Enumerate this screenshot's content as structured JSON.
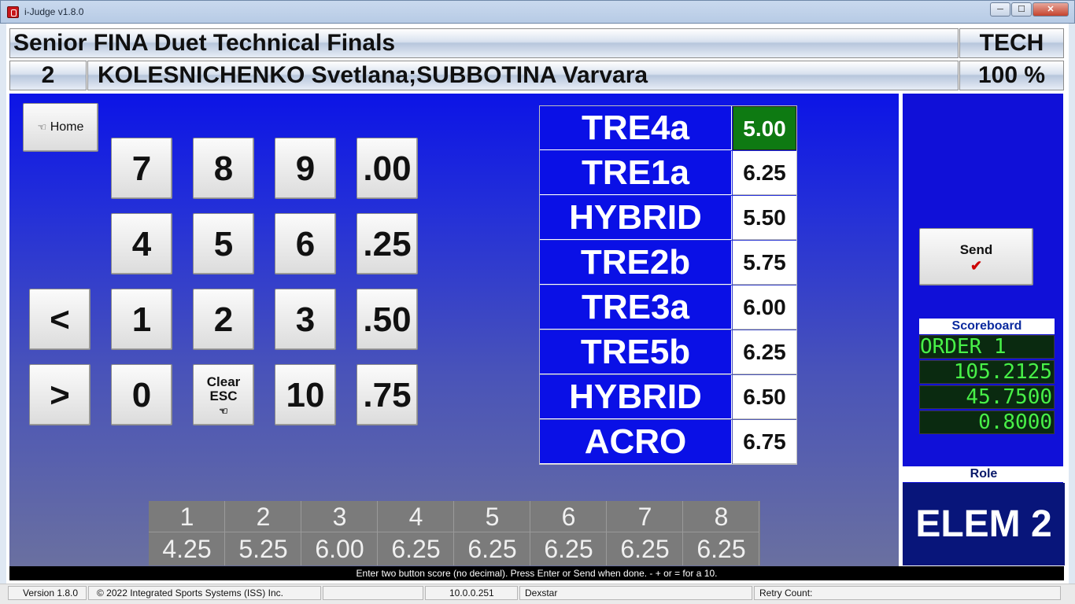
{
  "window": {
    "title": "i-Judge v1.8.0",
    "min": "─",
    "max": "☐",
    "close": "✕"
  },
  "header": {
    "event_title": "Senior FINA Duet Technical Finals",
    "category": "TECH",
    "start_number": "2",
    "competitors": "KOLESNICHENKO Svetlana;SUBBOTINA Varvara",
    "percent": "100 %"
  },
  "keypad": {
    "home": "Home",
    "keys": [
      "7",
      "8",
      "9",
      ".00",
      "4",
      "5",
      "6",
      ".25",
      "1",
      "2",
      "3",
      ".50",
      "0",
      "10",
      ".75"
    ],
    "prev": "<",
    "next": ">",
    "clear_line1": "Clear",
    "clear_line2": "ESC"
  },
  "elements": [
    {
      "name": "TRE4a",
      "score": "5.00",
      "active": true
    },
    {
      "name": "TRE1a",
      "score": "6.25"
    },
    {
      "name": "HYBRID",
      "score": "5.50"
    },
    {
      "name": "TRE2b",
      "score": "5.75"
    },
    {
      "name": "TRE3a",
      "score": "6.00"
    },
    {
      "name": "TRE5b",
      "score": "6.25"
    },
    {
      "name": "HYBRID",
      "score": "6.50"
    },
    {
      "name": "ACRO",
      "score": "6.75"
    }
  ],
  "summary": {
    "numbers": [
      "1",
      "2",
      "3",
      "4",
      "5",
      "6",
      "7",
      "8"
    ],
    "values": [
      "4.25",
      "5.25",
      "6.00",
      "6.25",
      "6.25",
      "6.25",
      "6.25",
      "6.25"
    ]
  },
  "send_label": "Send",
  "scoreboard": {
    "label": "Scoreboard",
    "line1": "ORDER   1",
    "line2": "105.2125",
    "line3": "45.7500",
    "line4": "0.8000"
  },
  "role": {
    "label": "Role",
    "value": "ELEM 2"
  },
  "instruction": "Enter two button score (no decimal). Press Enter or Send when done.   - + or = for a 10.",
  "status": {
    "version": "Version 1.8.0",
    "copyright": "© 2022 Integrated Sports Systems (ISS) Inc.",
    "blank": "",
    "ip": "10.0.0.251",
    "host": "Dexstar",
    "retry": "Retry Count:"
  }
}
